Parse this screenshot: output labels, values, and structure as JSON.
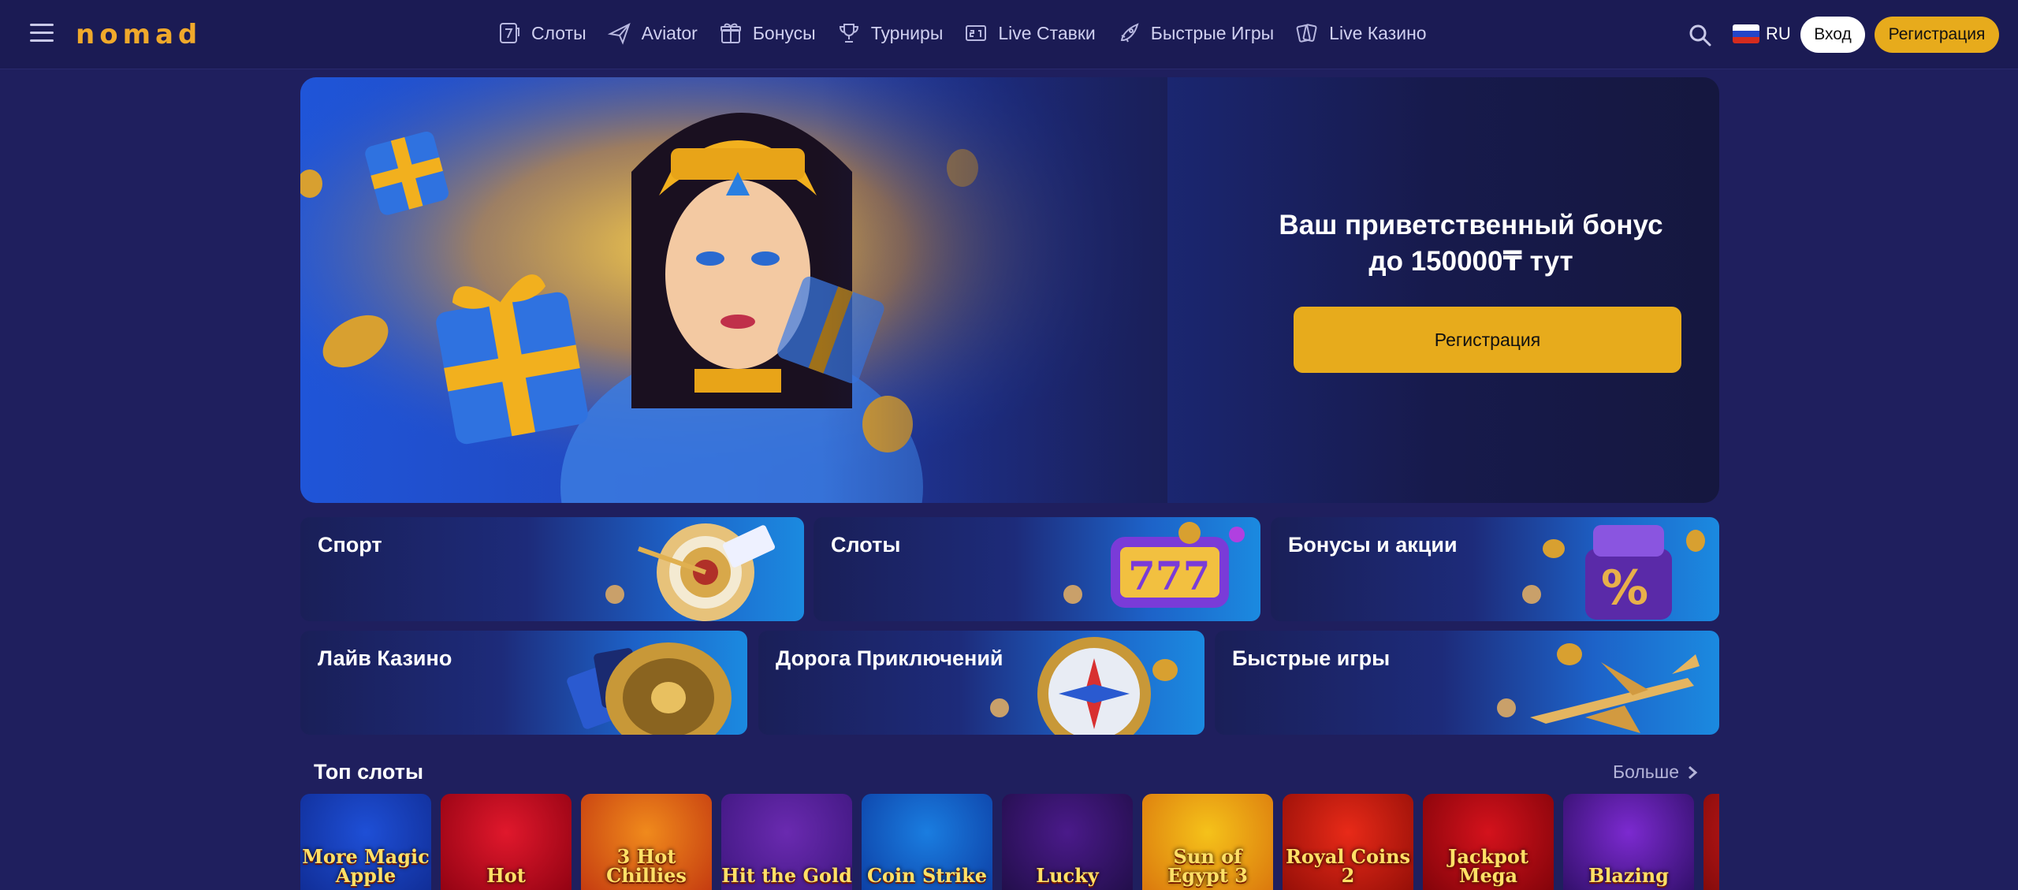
{
  "header": {
    "logo": "nomad",
    "nav": [
      {
        "label": "Слоты",
        "icon": "slot-7-icon"
      },
      {
        "label": "Aviator",
        "icon": "plane-icon"
      },
      {
        "label": "Бонусы",
        "icon": "gift-icon"
      },
      {
        "label": "Турниры",
        "icon": "trophy-icon"
      },
      {
        "label": "Live Ставки",
        "icon": "scoreboard-icon"
      },
      {
        "label": "Быстрые Игры",
        "icon": "rocket-icon"
      },
      {
        "label": "Live Казино",
        "icon": "cards-icon"
      }
    ],
    "language": "RU",
    "login_label": "Вход",
    "register_label": "Регистрация"
  },
  "hero": {
    "title_line1": "Ваш приветственный бонус",
    "title_line2": "до 150000₸ тут",
    "button_label": "Регистрация"
  },
  "categories": [
    {
      "label": "Спорт"
    },
    {
      "label": "Слоты"
    },
    {
      "label": "Бонусы и акции"
    },
    {
      "label": "Лайв Казино"
    },
    {
      "label": "Дорога Приключений"
    },
    {
      "label": "Быстрые игры"
    }
  ],
  "top_slots": {
    "title": "Топ слоты",
    "more_label": "Больше",
    "items": [
      {
        "title": "More Magic Apple",
        "color_a": "#1e4fd6",
        "color_b": "#0f2a90"
      },
      {
        "title": "Hot",
        "color_a": "#e0182c",
        "color_b": "#8a0010"
      },
      {
        "title": "3 Hot Chillies",
        "color_a": "#f08a1c",
        "color_b": "#c0330f"
      },
      {
        "title": "Hit the Gold",
        "color_a": "#6a2ab0",
        "color_b": "#3a157a"
      },
      {
        "title": "Coin Strike",
        "color_a": "#1a7de0",
        "color_b": "#0c3aa0"
      },
      {
        "title": "Lucky",
        "color_a": "#4a1a8a",
        "color_b": "#1e0d44"
      },
      {
        "title": "Sun of Egypt 3",
        "color_a": "#f5c21a",
        "color_b": "#d8700c"
      },
      {
        "title": "Royal Coins 2",
        "color_a": "#e82a18",
        "color_b": "#8c0c06"
      },
      {
        "title": "Jackpot Mega",
        "color_a": "#d4121c",
        "color_b": "#7a0208"
      },
      {
        "title": "Blazing",
        "color_a": "#7c2ad0",
        "color_b": "#2a0d60"
      },
      {
        "title": "",
        "color_a": "#d41a1a",
        "color_b": "#7a0a0a"
      }
    ]
  }
}
